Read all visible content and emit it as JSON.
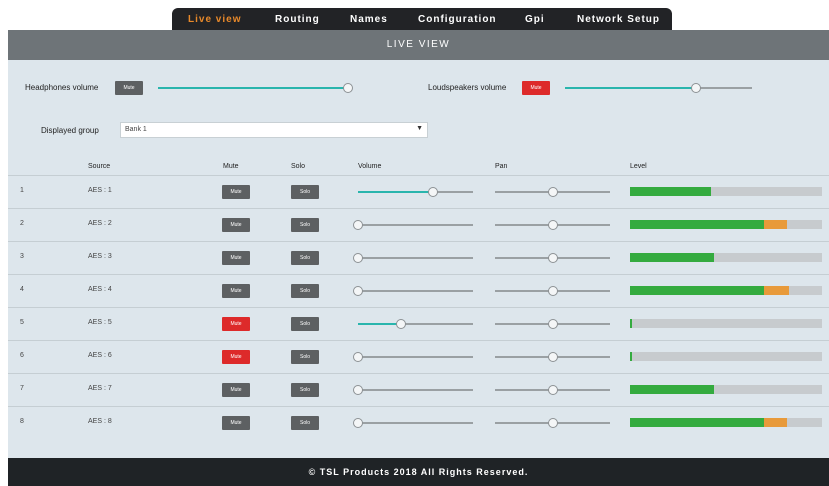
{
  "nav": {
    "items": [
      {
        "label": "Live view",
        "active": true
      },
      {
        "label": "Routing",
        "active": false
      },
      {
        "label": "Names",
        "active": false
      },
      {
        "label": "Configuration",
        "active": false
      },
      {
        "label": "Gpi",
        "active": false
      },
      {
        "label": "Network Setup",
        "active": false
      }
    ]
  },
  "title": "LIVE VIEW",
  "headphones": {
    "label": "Headphones volume",
    "mute_label": "Mute",
    "muted": false,
    "volume": 1.0
  },
  "loudspeakers": {
    "label": "Loudspeakers volume",
    "mute_label": "Mute",
    "muted": true,
    "volume": 0.7
  },
  "group": {
    "label": "Displayed group",
    "value": "Bank 1"
  },
  "table": {
    "headers": {
      "source": "Source",
      "mute": "Mute",
      "solo": "Solo",
      "volume": "Volume",
      "pan": "Pan",
      "level": "Level"
    },
    "rows": [
      {
        "num": "1",
        "source": "AES : 1",
        "mute_label": "Mute",
        "solo_label": "Solo",
        "muted": false,
        "volume": 0.65,
        "pan": 0.5,
        "level_green": 0.42,
        "level_orange": 0
      },
      {
        "num": "2",
        "source": "AES : 2",
        "mute_label": "Mute",
        "solo_label": "Solo",
        "muted": false,
        "volume": 0.0,
        "pan": 0.5,
        "level_green": 0.7,
        "level_orange": 0.12
      },
      {
        "num": "3",
        "source": "AES : 3",
        "mute_label": "Mute",
        "solo_label": "Solo",
        "muted": false,
        "volume": 0.0,
        "pan": 0.5,
        "level_green": 0.44,
        "level_orange": 0
      },
      {
        "num": "4",
        "source": "AES : 4",
        "mute_label": "Mute",
        "solo_label": "Solo",
        "muted": false,
        "volume": 0.0,
        "pan": 0.5,
        "level_green": 0.7,
        "level_orange": 0.13
      },
      {
        "num": "5",
        "source": "AES : 5",
        "mute_label": "Mute",
        "solo_label": "Solo",
        "muted": true,
        "volume": 0.37,
        "pan": 0.5,
        "level_green": 0.01,
        "level_orange": 0
      },
      {
        "num": "6",
        "source": "AES : 6",
        "mute_label": "Mute",
        "solo_label": "Solo",
        "muted": true,
        "volume": 0.0,
        "pan": 0.5,
        "level_green": 0.01,
        "level_orange": 0
      },
      {
        "num": "7",
        "source": "AES : 7",
        "mute_label": "Mute",
        "solo_label": "Solo",
        "muted": false,
        "volume": 0.0,
        "pan": 0.5,
        "level_green": 0.44,
        "level_orange": 0
      },
      {
        "num": "8",
        "source": "AES : 8",
        "mute_label": "Mute",
        "solo_label": "Solo",
        "muted": false,
        "volume": 0.0,
        "pan": 0.5,
        "level_green": 0.7,
        "level_orange": 0.12
      }
    ]
  },
  "footer": "© TSL Products 2018 All Rights Reserved.",
  "colors": {
    "accent": "#e8892a",
    "mute_active": "#dd2a2a",
    "slider_fill": "#29b5ad",
    "level_green": "#34ab3f",
    "level_orange": "#e89a3a"
  }
}
